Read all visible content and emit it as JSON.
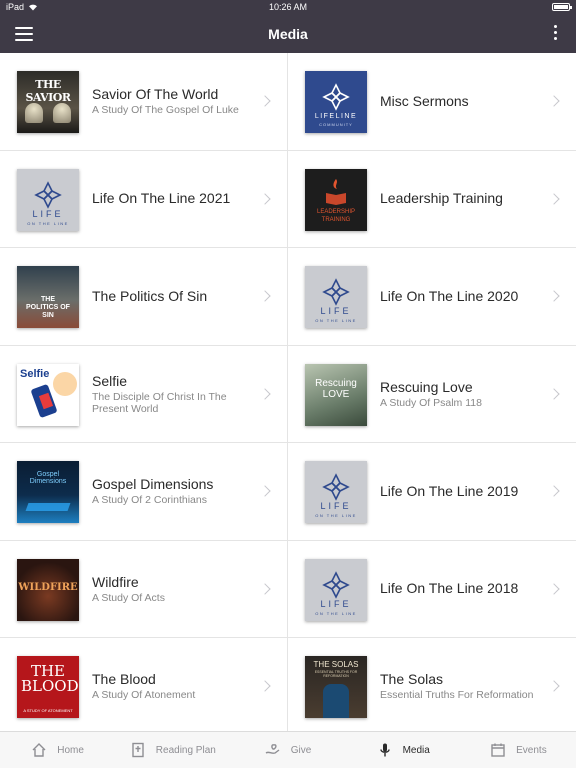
{
  "status": {
    "device": "iPad",
    "time": "10:26 AM",
    "battery_level": 1.0
  },
  "header": {
    "title": "Media"
  },
  "items": [
    {
      "title": "Savior Of The World",
      "subtitle": "A Study Of The Gospel Of Luke",
      "art_text": "THE SAVIOR"
    },
    {
      "title": "Misc Sermons",
      "subtitle": "",
      "art_text": "LIFELINE",
      "art_subtext": "COMMUNITY"
    },
    {
      "title": "Life On The Line 2021",
      "subtitle": "",
      "art_text": "LIFE",
      "art_subtext": "ON THE LINE"
    },
    {
      "title": "Leadership Training",
      "subtitle": "",
      "art_text": "LEADERSHIP",
      "art_subtext": "TRAINING"
    },
    {
      "title": "The Politics Of Sin",
      "subtitle": "",
      "art_text": "THE POLITICS OF SIN"
    },
    {
      "title": "Life On The Line 2020",
      "subtitle": "",
      "art_text": "LIFE",
      "art_subtext": "ON THE LINE"
    },
    {
      "title": "Selfie",
      "subtitle": "The Disciple Of Christ In The Present World",
      "art_text": "Selfie"
    },
    {
      "title": "Rescuing Love",
      "subtitle": "A Study Of Psalm 118",
      "art_text": "Rescuing LOVE"
    },
    {
      "title": "Gospel Dimensions",
      "subtitle": "A Study Of 2 Corinthians",
      "art_text": "Gospel Dimensions"
    },
    {
      "title": "Life On The Line 2019",
      "subtitle": "",
      "art_text": "LIFE",
      "art_subtext": "ON THE LINE"
    },
    {
      "title": "Wildfire",
      "subtitle": "A Study Of Acts",
      "art_text": "WILDFIRE"
    },
    {
      "title": "Life On The Line 2018",
      "subtitle": "",
      "art_text": "LIFE",
      "art_subtext": "ON THE LINE"
    },
    {
      "title": "The Blood",
      "subtitle": "A Study Of Atonement",
      "art_text": "THE BLOOD",
      "art_subtext": "A STUDY OF ATONEMENT"
    },
    {
      "title": "The Solas",
      "subtitle": "Essential Truths For Reformation",
      "art_text": "THE SOLAS",
      "art_subtext": "ESSENTIAL TRUTHS FOR REFORMATION"
    }
  ],
  "tabs": [
    {
      "label": "Home",
      "icon": "home-icon"
    },
    {
      "label": "Reading Plan",
      "icon": "bible-icon"
    },
    {
      "label": "Give",
      "icon": "give-icon"
    },
    {
      "label": "Media",
      "icon": "microphone-icon",
      "active": true
    },
    {
      "label": "Events",
      "icon": "calendar-icon"
    }
  ],
  "colors": {
    "navbar": "#3e3a46",
    "lifeline_blue": "#2f4a8e",
    "blood_red": "#b5161b"
  }
}
